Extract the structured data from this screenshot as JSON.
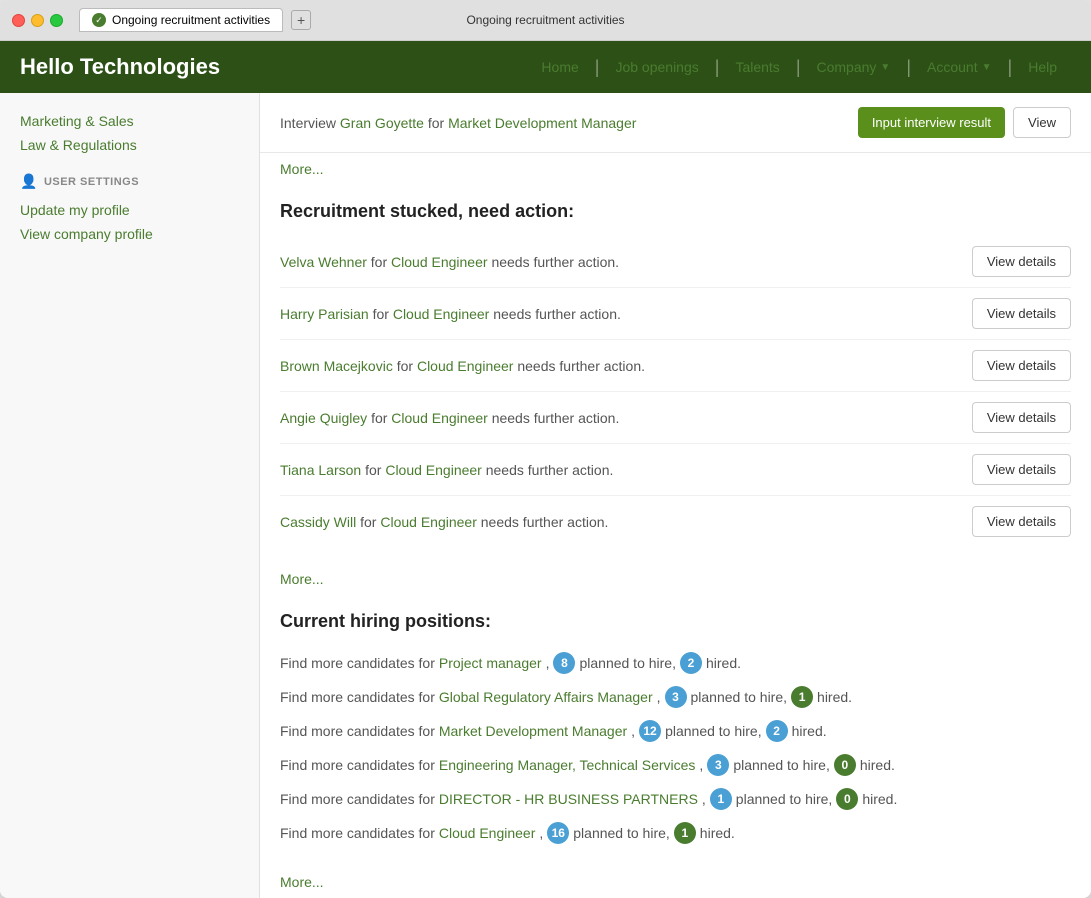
{
  "window": {
    "title": "Ongoing recruitment activities",
    "tab_label": "Ongoing recruitment activities"
  },
  "navbar": {
    "brand": "Hello Technologies",
    "nav_items": [
      {
        "label": "Home",
        "has_arrow": false
      },
      {
        "label": "Job openings",
        "has_arrow": false
      },
      {
        "label": "Talents",
        "has_arrow": false
      },
      {
        "label": "Company",
        "has_arrow": true
      },
      {
        "label": "Account",
        "has_arrow": true
      },
      {
        "label": "Help",
        "has_arrow": false
      }
    ]
  },
  "sidebar": {
    "links": [
      {
        "label": "Marketing & Sales"
      },
      {
        "label": "Law & Regulations"
      }
    ],
    "section_title": "USER SETTINGS",
    "user_links": [
      {
        "label": "Update my profile"
      },
      {
        "label": "View company profile"
      }
    ]
  },
  "interview_row": {
    "prefix": "Interview",
    "person": "Gran Goyette",
    "for_text": "for",
    "position": "Market Development Manager",
    "btn_primary": "Input interview result",
    "btn_secondary": "View"
  },
  "more_links": [
    {
      "label": "More..."
    },
    {
      "label": "More..."
    },
    {
      "label": "More..."
    }
  ],
  "stucked_section": {
    "title": "Recruitment stucked, need action:",
    "items": [
      {
        "person": "Velva Wehner",
        "for_text": "for",
        "position": "Cloud Engineer",
        "suffix": "needs further action.",
        "btn": "View details"
      },
      {
        "person": "Harry Parisian",
        "for_text": "for",
        "position": "Cloud Engineer",
        "suffix": "needs further action.",
        "btn": "View details"
      },
      {
        "person": "Brown Macejkovic",
        "for_text": "for",
        "position": "Cloud Engineer",
        "suffix": "needs further action.",
        "btn": "View details"
      },
      {
        "person": "Angie Quigley",
        "for_text": "for",
        "position": "Cloud Engineer",
        "suffix": "needs further action.",
        "btn": "View details"
      },
      {
        "person": "Tiana Larson",
        "for_text": "for",
        "position": "Cloud Engineer",
        "suffix": "needs further action.",
        "btn": "View details"
      },
      {
        "person": "Cassidy Will",
        "for_text": "for",
        "position": "Cloud Engineer",
        "suffix": "needs further action.",
        "btn": "View details"
      }
    ]
  },
  "hiring_section": {
    "title": "Current hiring positions:",
    "items": [
      {
        "prefix": "Find more candidates for",
        "position": "Project manager",
        "planned": 8,
        "hired": 2,
        "badge_planned": "blue",
        "badge_hired": "blue"
      },
      {
        "prefix": "Find more candidates for",
        "position": "Global Regulatory Affairs Manager",
        "planned": 3,
        "hired": 1,
        "badge_planned": "blue",
        "badge_hired": "green"
      },
      {
        "prefix": "Find more candidates for",
        "position": "Market Development Manager",
        "planned": 12,
        "hired": 2,
        "badge_planned": "blue",
        "badge_hired": "blue"
      },
      {
        "prefix": "Find more candidates for",
        "position": "Engineering Manager, Technical Services",
        "planned": 3,
        "hired": 0,
        "badge_planned": "blue",
        "badge_hired": "green"
      },
      {
        "prefix": "Find more candidates for",
        "position": "DIRECTOR - HR BUSINESS PARTNERS",
        "planned": 1,
        "hired": 0,
        "badge_planned": "blue",
        "badge_hired": "green"
      },
      {
        "prefix": "Find more candidates for",
        "position": "Cloud Engineer",
        "planned": 16,
        "hired": 1,
        "badge_planned": "blue",
        "badge_hired": "green"
      }
    ]
  },
  "labels": {
    "planned_to_hire": "planned to hire,",
    "hired": "hired."
  }
}
